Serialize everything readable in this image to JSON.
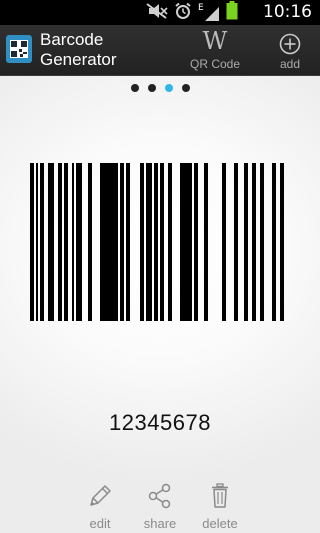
{
  "status_bar": {
    "time": "10:16",
    "network_label": "E",
    "icons": [
      "notifications-muted-icon",
      "alarm-icon",
      "signal-icon",
      "battery-icon"
    ]
  },
  "action_bar": {
    "title_line1": "Barcode",
    "title_line2": "Generator",
    "qr_glyph": "W",
    "qr_label": "QR Code",
    "add_label": "add"
  },
  "pager": {
    "page_count": 4,
    "active_index": 2,
    "active_color": "#33b5e5"
  },
  "barcode": {
    "value": "12345678"
  },
  "bottom_actions": {
    "edit_label": "edit",
    "share_label": "share",
    "delete_label": "delete"
  }
}
